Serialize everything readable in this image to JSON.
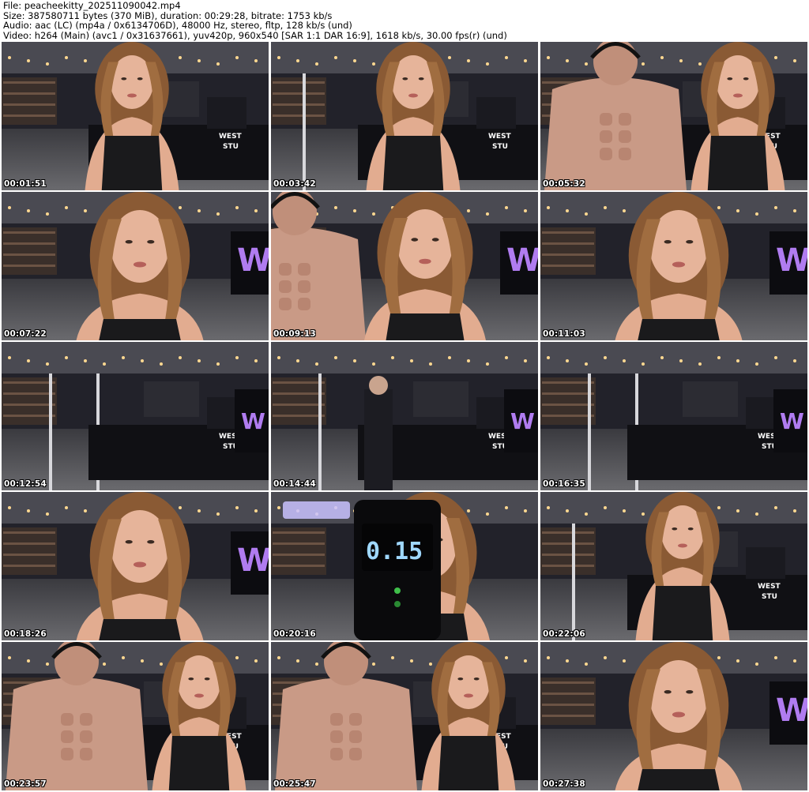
{
  "header": {
    "file": "File: peacheekitty_202511090042.mp4",
    "size": "Size: 387580711 bytes (370 MiB), duration: 00:29:28, bitrate: 1753 kb/s",
    "audio": "Audio: aac (LC) (mp4a / 0x6134706D), 48000 Hz, stereo, fltp, 128 kb/s (und)",
    "video": "Video: h264 (Main) (avc1 / 0x31637661), yuv420p, 960x540 [SAR 1:1 DAR 16:9], 1618 kb/s, 30.00 fps(r) (und)"
  },
  "thumbnails": [
    {
      "timestamp": "00:01:51",
      "scene": "woman-foreground"
    },
    {
      "timestamp": "00:03:42",
      "scene": "woman-standing"
    },
    {
      "timestamp": "00:05:32",
      "scene": "man-and-woman"
    },
    {
      "timestamp": "00:07:22",
      "scene": "woman-closeup"
    },
    {
      "timestamp": "00:09:13",
      "scene": "woman-looking-down"
    },
    {
      "timestamp": "00:11:03",
      "scene": "woman-closeup"
    },
    {
      "timestamp": "00:12:54",
      "scene": "venue-empty"
    },
    {
      "timestamp": "00:14:44",
      "scene": "venue-passerby"
    },
    {
      "timestamp": "00:16:35",
      "scene": "venue-empty"
    },
    {
      "timestamp": "00:18:26",
      "scene": "woman-closeup"
    },
    {
      "timestamp": "00:20:16",
      "scene": "device-readout"
    },
    {
      "timestamp": "00:22:06",
      "scene": "woman-standing"
    },
    {
      "timestamp": "00:23:57",
      "scene": "man-and-woman"
    },
    {
      "timestamp": "00:25:47",
      "scene": "man-and-woman"
    },
    {
      "timestamp": "00:27:38",
      "scene": "woman-closeup"
    }
  ],
  "device_readout": "0.15",
  "signs": {
    "distillery_big": "W",
    "distillery_small": "WEST",
    "distillery_small2": "STU"
  },
  "colors": {
    "background": "#ffffff",
    "text": "#000000",
    "timestamp": "#ffffff",
    "sign_purple": "#b07cf0",
    "device_display": "#9fd8ff"
  }
}
